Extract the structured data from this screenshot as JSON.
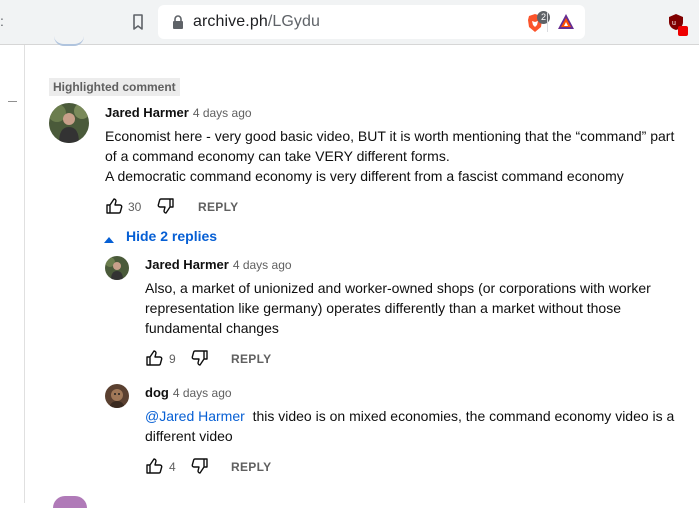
{
  "browser": {
    "url_host": "archive.ph",
    "url_path": "/LGydu",
    "brave_badge": "2"
  },
  "comment": {
    "highlight_label": "Highlighted comment",
    "author": "Jared Harmer",
    "time": "4 days ago",
    "lines": [
      "Economist here - very good basic video, BUT it is worth mentioning that the “command” part",
      "of a command economy can take VERY different forms.",
      "A democratic command economy is very different from a fascist command economy"
    ],
    "likes": "30",
    "reply_label": "REPLY",
    "hide_replies_label": "Hide 2 replies"
  },
  "replies": [
    {
      "author": "Jared Harmer",
      "time": "4 days ago",
      "lines": [
        "Also, a market of unionized and worker-owned shops (or corporations with worker",
        "representation like germany) operates differently than a market without those",
        "fundamental changes"
      ],
      "likes": "9",
      "reply_label": "REPLY"
    },
    {
      "author": "dog",
      "time": "4 days ago",
      "mention": "@Jared Harmer",
      "line1_rest": "this video is on mixed economies, the command economy video is a",
      "line2": "different video",
      "likes": "4",
      "reply_label": "REPLY"
    }
  ],
  "colors": {
    "link": "#065fd4",
    "text": "#0f0f0f",
    "secondary": "#606060"
  }
}
